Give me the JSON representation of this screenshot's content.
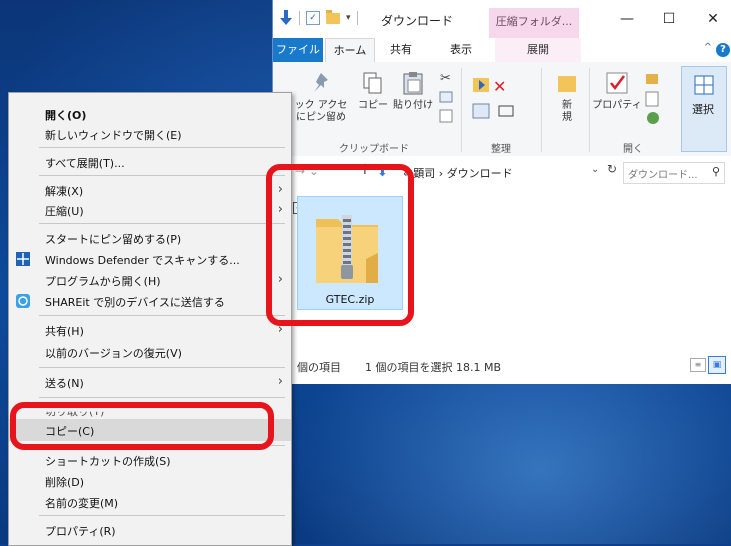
{
  "explorer": {
    "title": "ダウンロード",
    "context_tab": "圧縮フォルダ...",
    "window_buttons": {
      "minimize": "—",
      "maximize": "☐",
      "close": "✕"
    },
    "tabs": {
      "file": "ファイル",
      "home": "ホーム",
      "share": "共有",
      "view": "表示",
      "manage": "展開"
    },
    "ribbon": {
      "pin_quick_access_line1": "ック アクセ",
      "pin_quick_access_line2": "にピン留め",
      "copy": "コピー",
      "paste": "貼り付け",
      "new": "新",
      "new_line2": "規",
      "properties": "プロパティ",
      "select": "選択",
      "groups": {
        "clipboard": "クリップボード",
        "organize": "整理",
        "open": "開く"
      }
    },
    "address": {
      "path": "« 顕司  ›  ダウンロード",
      "search_placeholder": "ダウンロード..."
    },
    "file": {
      "name": "GTEC.zip"
    },
    "status": {
      "count": "個の項目",
      "selected": "1 個の項目を選択  18.1 MB"
    }
  },
  "context_menu": {
    "items": [
      {
        "label": "開く(O)",
        "default": true
      },
      {
        "label": "新しいウィンドウで開く(E)"
      },
      {
        "label": "すべて展開(T)..."
      },
      {
        "label": "解凍(X)",
        "submenu": true
      },
      {
        "label": "圧縮(U)",
        "submenu": true
      },
      {
        "label": "スタートにピン留めする(P)"
      },
      {
        "label": "Windows Defender でスキャンする..."
      },
      {
        "label": "プログラムから開く(H)",
        "submenu": true
      },
      {
        "label": "SHAREit で別のデバイスに送信する"
      },
      {
        "label": "共有(H)",
        "submenu": true
      },
      {
        "label": "以前のバージョンの復元(V)"
      },
      {
        "label": "送る(N)",
        "submenu": true
      },
      {
        "label": "切り取り(T)"
      },
      {
        "label": "コピー(C)",
        "highlighted": true
      },
      {
        "label": "ショートカットの作成(S)"
      },
      {
        "label": "削除(D)"
      },
      {
        "label": "名前の変更(M)"
      },
      {
        "label": "プロパティ(R)"
      }
    ]
  },
  "colors": {
    "annotation": "#e8141b",
    "accent": "#1979ca",
    "selection": "#cce8ff"
  }
}
